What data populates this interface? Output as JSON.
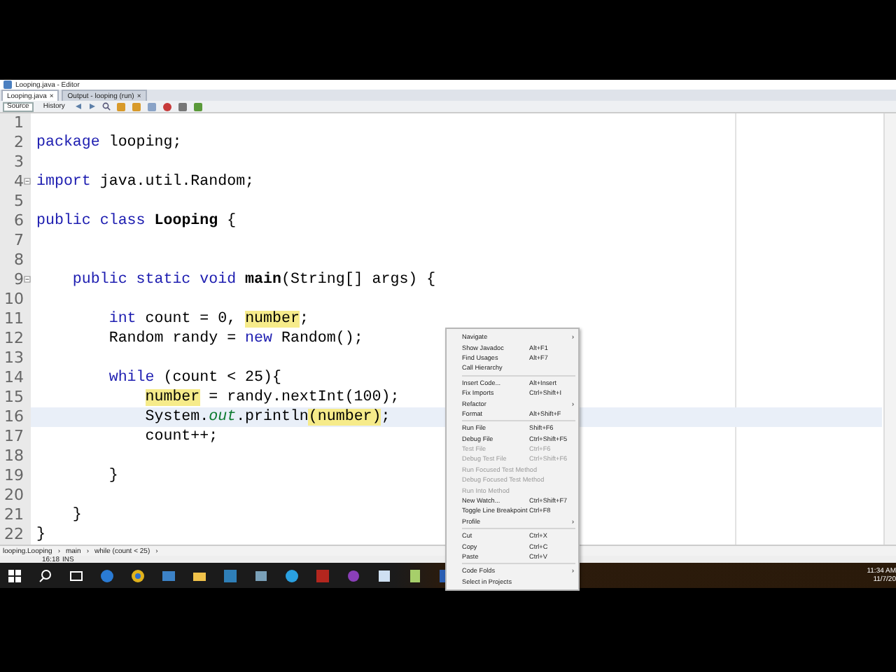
{
  "window": {
    "title": "Looping.java - Editor"
  },
  "tabs": [
    {
      "label": "Looping.java",
      "close": "×",
      "selected": true
    },
    {
      "label": "Output - looping (run)",
      "close": "×",
      "selected": false
    }
  ],
  "view_buttons": [
    {
      "label": "Source",
      "selected": true
    },
    {
      "label": "History",
      "selected": false
    }
  ],
  "lines": [
    {
      "number": "1",
      "current": false,
      "fold": false
    },
    {
      "number": "2",
      "current": false,
      "fold": false,
      "tokens": [
        {
          "kind": "kw",
          "text": "package"
        },
        {
          "kind": "plain",
          "text": " looping;"
        }
      ]
    },
    {
      "number": "3",
      "current": false,
      "fold": false
    },
    {
      "number": "4",
      "current": false,
      "fold": true,
      "tokens": [
        {
          "kind": "kw",
          "text": "import"
        },
        {
          "kind": "plain",
          "text": " java.util.Random;"
        }
      ]
    },
    {
      "number": "5",
      "current": false,
      "fold": false
    },
    {
      "number": "6",
      "current": false,
      "fold": false,
      "tokens": [
        {
          "kind": "kw",
          "text": "public class"
        },
        {
          "kind": "bold",
          "text": " Looping"
        },
        {
          "kind": "plain",
          "text": " {"
        }
      ]
    },
    {
      "number": "7",
      "current": false,
      "fold": false
    },
    {
      "number": "8",
      "current": false,
      "fold": false
    },
    {
      "number": "9",
      "current": false,
      "fold": true,
      "tokens": [
        {
          "kind": "kw",
          "text": "    public static void"
        },
        {
          "kind": "bold",
          "text": " main"
        },
        {
          "kind": "plain",
          "text": "(String[] args) {"
        }
      ]
    },
    {
      "number": "10",
      "current": false,
      "fold": false
    },
    {
      "number": "11",
      "current": false,
      "fold": false,
      "tokens": [
        {
          "kind": "kw",
          "text": "        int"
        },
        {
          "kind": "plain",
          "text": " count = 0, "
        },
        {
          "kind": "mark",
          "text": "number"
        },
        {
          "kind": "plain",
          "text": ";"
        }
      ]
    },
    {
      "number": "12",
      "current": false,
      "fold": false,
      "tokens": [
        {
          "kind": "plain",
          "text": "        Random randy = "
        },
        {
          "kind": "kw",
          "text": "new"
        },
        {
          "kind": "plain",
          "text": " Random();"
        }
      ]
    },
    {
      "number": "13",
      "current": false,
      "fold": false
    },
    {
      "number": "14",
      "current": false,
      "fold": false,
      "tokens": [
        {
          "kind": "kw",
          "text": "        while"
        },
        {
          "kind": "plain",
          "text": " (count < 25){"
        }
      ]
    },
    {
      "number": "15",
      "current": false,
      "fold": false,
      "tokens": [
        {
          "kind": "mark",
          "text": "            number"
        },
        {
          "kind": "plain",
          "text": " = randy.nextInt(100);"
        }
      ]
    },
    {
      "number": "16",
      "current": true,
      "fold": false,
      "tokens": [
        {
          "kind": "plain",
          "text": "            System."
        },
        {
          "kind": "field",
          "text": "out"
        },
        {
          "kind": "plain",
          "text": ".println"
        },
        {
          "kind": "mark",
          "text": "(number)"
        },
        {
          "kind": "plain",
          "text": ";"
        }
      ]
    },
    {
      "number": "17",
      "current": false,
      "fold": false,
      "tokens": [
        {
          "kind": "plain",
          "text": "            count++;"
        }
      ]
    },
    {
      "number": "18",
      "current": false,
      "fold": false
    },
    {
      "number": "19",
      "current": false,
      "fold": false,
      "tokens": [
        {
          "kind": "plain",
          "text": "        }"
        }
      ]
    },
    {
      "number": "20",
      "current": false,
      "fold": false
    },
    {
      "number": "21",
      "current": false,
      "fold": false,
      "tokens": [
        {
          "kind": "plain",
          "text": "    }"
        }
      ]
    },
    {
      "number": "22",
      "current": false,
      "fold": false,
      "tokens": [
        {
          "kind": "plain",
          "text": "}"
        }
      ]
    }
  ],
  "context_menu": [
    {
      "kind": "item",
      "label": "Navigate",
      "arrow": "›",
      "disabled": false
    },
    {
      "kind": "item",
      "label": "Show Javadoc",
      "shortcut": "Alt+F1",
      "disabled": false
    },
    {
      "kind": "item",
      "label": "Find Usages",
      "shortcut": "Alt+F7",
      "disabled": false
    },
    {
      "kind": "item",
      "label": "Call Hierarchy",
      "disabled": false
    },
    {
      "kind": "separator"
    },
    {
      "kind": "item",
      "label": "Insert Code...",
      "shortcut": "Alt+Insert",
      "disabled": false
    },
    {
      "kind": "item",
      "label": "Fix Imports",
      "shortcut": "Ctrl+Shift+I",
      "disabled": false
    },
    {
      "kind": "item",
      "label": "Refactor",
      "arrow": "›",
      "disabled": false
    },
    {
      "kind": "item",
      "label": "Format",
      "shortcut": "Alt+Shift+F",
      "disabled": false
    },
    {
      "kind": "separator"
    },
    {
      "kind": "item",
      "label": "Run File",
      "shortcut": "Shift+F6",
      "disabled": false
    },
    {
      "kind": "item",
      "label": "Debug File",
      "shortcut": "Ctrl+Shift+F5",
      "disabled": false
    },
    {
      "kind": "item",
      "label": "Test File",
      "shortcut": "Ctrl+F6",
      "disabled": true
    },
    {
      "kind": "item",
      "label": "Debug Test File",
      "shortcut": "Ctrl+Shift+F6",
      "disabled": true
    },
    {
      "kind": "item",
      "label": "Run Focused Test Method",
      "disabled": true
    },
    {
      "kind": "item",
      "label": "Debug Focused Test Method",
      "disabled": true
    },
    {
      "kind": "item",
      "label": "Run Into Method",
      "disabled": true
    },
    {
      "kind": "item",
      "label": "New Watch...",
      "shortcut": "Ctrl+Shift+F7",
      "disabled": false
    },
    {
      "kind": "item",
      "label": "Toggle Line Breakpoint",
      "shortcut": "Ctrl+F8",
      "disabled": false
    },
    {
      "kind": "item",
      "label": "Profile",
      "arrow": "›",
      "disabled": false
    },
    {
      "kind": "separator"
    },
    {
      "kind": "item",
      "label": "Cut",
      "shortcut": "Ctrl+X",
      "disabled": false
    },
    {
      "kind": "item",
      "label": "Copy",
      "shortcut": "Ctrl+C",
      "disabled": false
    },
    {
      "kind": "item",
      "label": "Paste",
      "shortcut": "Ctrl+V",
      "disabled": false
    },
    {
      "kind": "separator"
    },
    {
      "kind": "item",
      "label": "Code Folds",
      "arrow": "›",
      "disabled": false
    },
    {
      "kind": "item",
      "label": "Select in Projects",
      "disabled": false
    }
  ],
  "breadcrumbs": [
    {
      "label": "looping.Looping",
      "sep": "›"
    },
    {
      "label": "main",
      "sep": "›"
    },
    {
      "label": "while (count < 25)",
      "sep": "›"
    }
  ],
  "status_bar": {
    "position": "16:18",
    "mode": "INS"
  },
  "taskbar": {
    "time": "11:34 AM",
    "date": "11/7/20"
  }
}
